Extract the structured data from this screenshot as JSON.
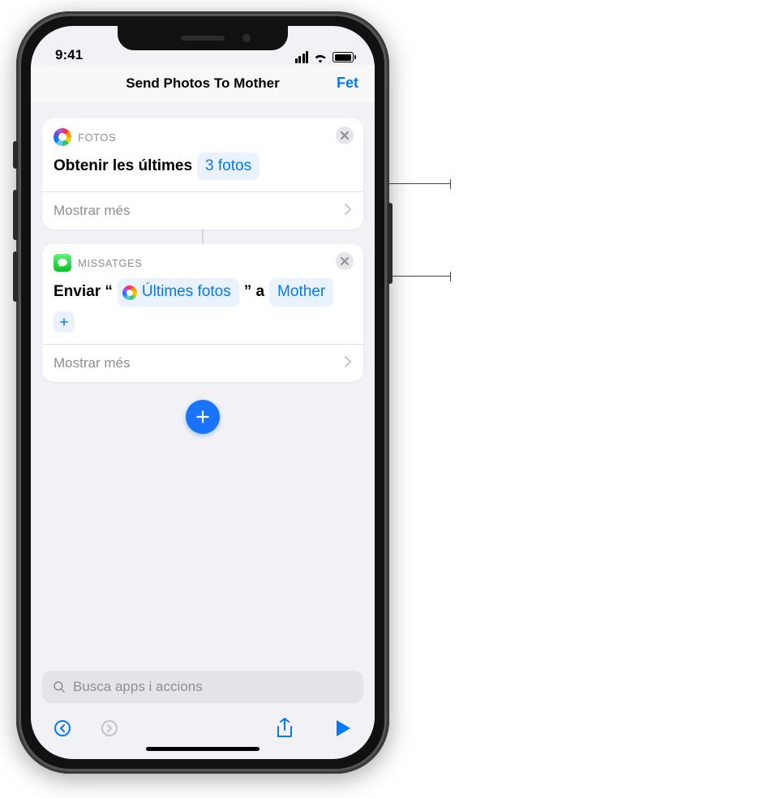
{
  "statusbar": {
    "time": "9:41"
  },
  "navbar": {
    "title": "Send Photos To Mother",
    "done": "Fet"
  },
  "action_photos": {
    "app_label": "FOTOS",
    "text_prefix": "Obtenir les últimes",
    "param_token": "3 fotos",
    "show_more": "Mostrar més"
  },
  "action_messages": {
    "app_label": "MISSATGES",
    "text_prefix": "Enviar “",
    "input_token": "Últimes fotos",
    "text_mid": "” a",
    "recipient_token": "Mother",
    "show_more": "Mostrar més"
  },
  "search": {
    "placeholder": "Busca apps i accions"
  }
}
